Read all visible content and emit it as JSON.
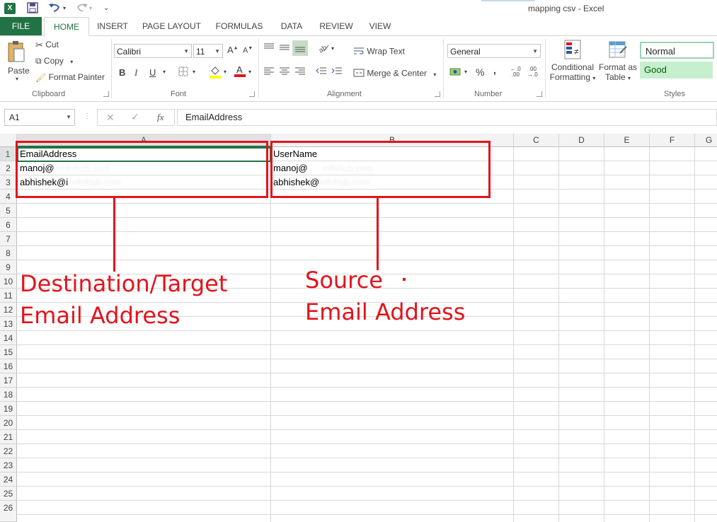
{
  "window": {
    "title": "mapping csv - Excel"
  },
  "tabs": [
    "FILE",
    "HOME",
    "INSERT",
    "PAGE LAYOUT",
    "FORMULAS",
    "DATA",
    "REVIEW",
    "VIEW"
  ],
  "clipboard": {
    "paste": "Paste",
    "cut": "Cut",
    "copy": "Copy",
    "format_painter": "Format Painter",
    "label": "Clipboard"
  },
  "font": {
    "name": "Calibri",
    "size": "11",
    "label": "Font",
    "bold": "B",
    "italic": "I",
    "underline": "U"
  },
  "alignment": {
    "wrap_text": "Wrap Text",
    "merge_center": "Merge & Center",
    "label": "Alignment"
  },
  "number": {
    "format": "General",
    "percent": "%",
    "comma": ",",
    "label": "Number"
  },
  "styles": {
    "conditional": [
      "Conditional",
      "Formatting"
    ],
    "format_table": [
      "Format as",
      "Table"
    ],
    "normal": "Normal",
    "good": "Good",
    "label": "Styles"
  },
  "formula_bar": {
    "name_box": "A1",
    "fx": "fx",
    "value": "EmailAddress"
  },
  "columns": [
    "A",
    "B",
    "C",
    "D",
    "E",
    "F",
    "G"
  ],
  "rows": [
    "1",
    "2",
    "3",
    "4",
    "5",
    "6",
    "7",
    "8",
    "9",
    "10",
    "11",
    "12",
    "13",
    "14",
    "15",
    "16",
    "17",
    "18",
    "19",
    "20",
    "21",
    "22",
    "23",
    "24",
    "25",
    "26"
  ],
  "cells": {
    "a1": "EmailAddress",
    "a2_visible": "manoj@",
    "a2_blurred": "fonfohub.com",
    "a3_visible": "abhishek@i",
    "a3_blurred": "onfohub.com",
    "b1": "UserName",
    "b2_visible": "manoj@",
    "b2_blurred": "infohub.com",
    "b3_visible": "abhishek@",
    "b3_blurred": "infohub.com"
  },
  "annotations": {
    "destination": [
      "Destination/Target",
      "Email Address"
    ],
    "source": [
      "Source",
      "Email Address"
    ],
    "accent_color": "#e2141c"
  },
  "colors": {
    "excel_green": "#217346",
    "good_fill": "#c6efce",
    "good_text": "#006100"
  }
}
